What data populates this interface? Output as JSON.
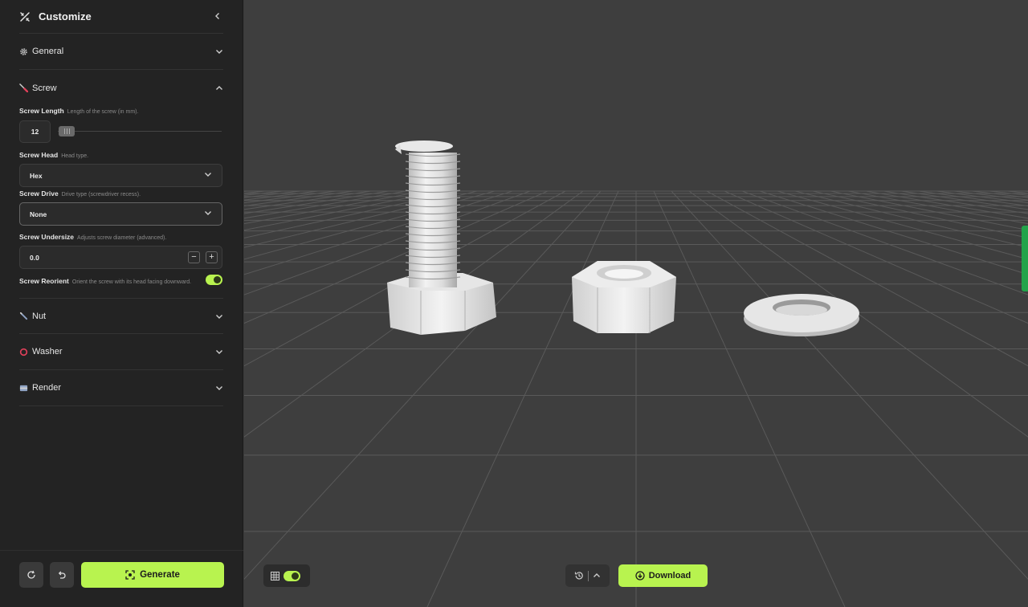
{
  "sidebar": {
    "title": "Customize",
    "sections": {
      "general": "General",
      "screw": "Screw",
      "nut": "Nut",
      "washer": "Washer",
      "render": "Render"
    },
    "screw": {
      "length_label": "Screw Length",
      "length_hint": "Length of the screw (in mm).",
      "length_value": "12",
      "head_label": "Screw Head",
      "head_hint": "Head type.",
      "head_value": "Hex",
      "drive_label": "Screw Drive",
      "drive_hint": "Drive type (screwdriver recess).",
      "drive_value": "None",
      "undersize_label": "Screw Undersize",
      "undersize_hint": "Adjusts screw diameter (advanced).",
      "undersize_value": "0.0",
      "reorient_label": "Screw Reorient",
      "reorient_hint": "Orient the screw with its head facing downward.",
      "reorient_on": true
    },
    "footer": {
      "generate_label": "Generate"
    }
  },
  "viewport": {
    "grid_toggle_on": true,
    "download_label": "Download"
  },
  "colors": {
    "accent": "#b8f34f",
    "panel": "#232323",
    "viewport_bg": "#3e3e3e",
    "washer_icon": "#e0405a",
    "side_tab": "#22a34a"
  },
  "icons": [
    "customize-icon",
    "chevron-left-icon",
    "gear-icon",
    "screwdriver-icon",
    "wrench-icon",
    "ring-icon",
    "render-icon",
    "chevron-down-icon",
    "chevron-up-icon",
    "reset-icon",
    "undo-icon",
    "generate-icon",
    "grid-icon",
    "history-icon",
    "download-icon"
  ]
}
